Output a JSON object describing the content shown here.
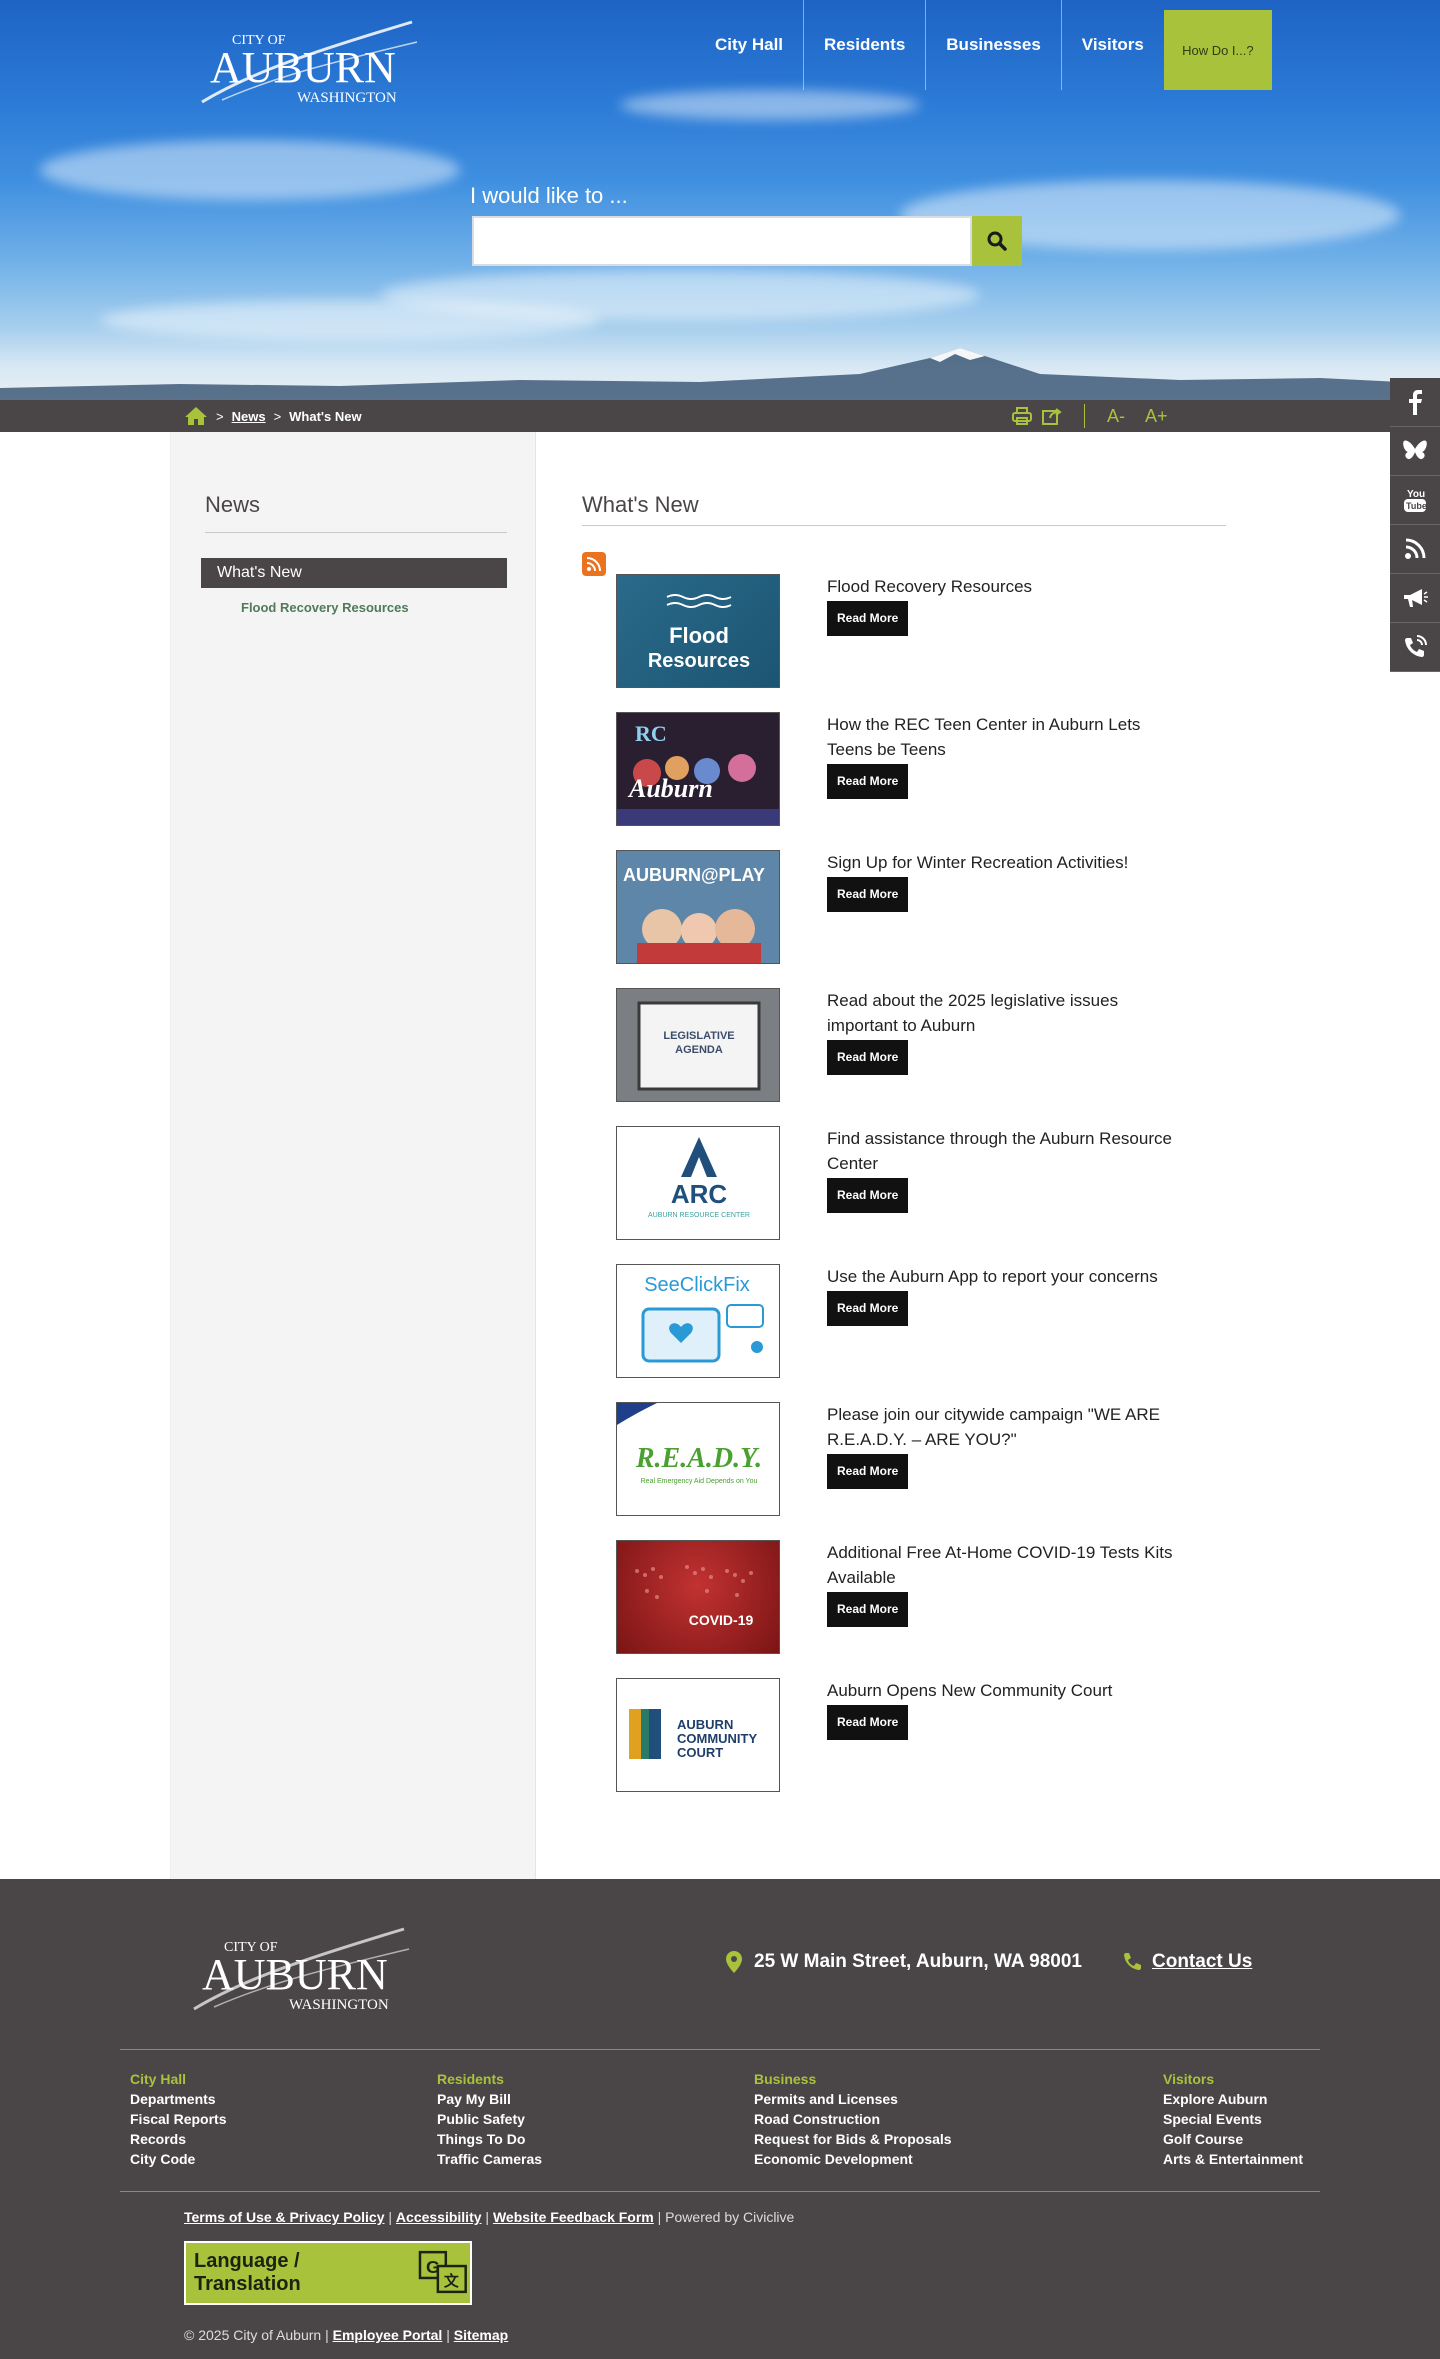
{
  "header": {
    "logo": {
      "top": "CITY OF",
      "main": "AUBURN",
      "sub": "WASHINGTON"
    },
    "nav": [
      {
        "label": "City Hall"
      },
      {
        "label": "Residents"
      },
      {
        "label": "Businesses"
      },
      {
        "label": "Visitors"
      },
      {
        "label": "How Do I...?"
      }
    ],
    "search": {
      "label": "I would like to ...",
      "value": "",
      "placeholder": ""
    }
  },
  "breadcrumb": {
    "items": [
      "News",
      "What's New"
    ]
  },
  "tools": {
    "font_decrease": "A-",
    "font_increase": "A+"
  },
  "colors": {
    "accent": "#a9c23c",
    "dark": "#4a4648",
    "rss": "#e9731f"
  },
  "social": [
    "facebook-icon",
    "bluesky-icon",
    "youtube-icon",
    "rss-icon",
    "megaphone-icon",
    "phone-alert-icon"
  ],
  "sidebar": {
    "title": "News",
    "active": "What's New",
    "sub": "Flood Recovery Resources"
  },
  "main": {
    "title": "What's New",
    "read_more": "Read More",
    "items": [
      {
        "title": "Flood Recovery Resources",
        "thumb": "Flood\nResources"
      },
      {
        "title": "How the REC Teen Center in Auburn Lets Teens be Teens",
        "thumb": "Auburn"
      },
      {
        "title": "Sign Up for Winter Recreation Activities!",
        "thumb": "AUBURN@PLAY"
      },
      {
        "title": "Read about the 2025 legislative issues important to Auburn",
        "thumb": "LEGISLATIVE AGENDA"
      },
      {
        "title": "Find assistance through the Auburn Resource Center",
        "thumb": "ARC"
      },
      {
        "title": "Use the Auburn App to report your concerns",
        "thumb": "SeeClickFix"
      },
      {
        "title": "Please join our citywide campaign \"WE ARE R.E.A.D.Y. – ARE YOU?\"",
        "thumb": "R.E.A.D.Y."
      },
      {
        "title": "Additional Free At-Home COVID-19 Tests Kits Available",
        "thumb": "COVID-19"
      },
      {
        "title": "Auburn Opens New Community Court",
        "thumb": "AUBURN COMMUNITY COURT"
      }
    ]
  },
  "footer": {
    "address": "25 W Main Street, Auburn, WA 98001",
    "contact": "Contact Us",
    "columns": [
      {
        "head": "City Hall",
        "links": [
          "Departments",
          "Fiscal Reports",
          "Records",
          "City Code"
        ]
      },
      {
        "head": "Residents",
        "links": [
          "Pay My Bill",
          "Public Safety",
          "Things To Do",
          "Traffic Cameras"
        ]
      },
      {
        "head": "Business",
        "links": [
          "Permits and Licenses",
          "Road Construction",
          "Request for Bids & Proposals",
          "Economic Development"
        ]
      },
      {
        "head": "Visitors",
        "links": [
          "Explore Auburn",
          "Special Events",
          "Golf Course",
          "Arts & Entertainment"
        ]
      }
    ],
    "legal": [
      "Terms of Use & Privacy Policy",
      "Accessibility",
      "Website Feedback Form"
    ],
    "powered": "Powered by Civiclive",
    "language": "Language / Translation",
    "copyright": "© 2025 City of Auburn",
    "copy_links": [
      "Employee Portal",
      "Sitemap"
    ]
  }
}
